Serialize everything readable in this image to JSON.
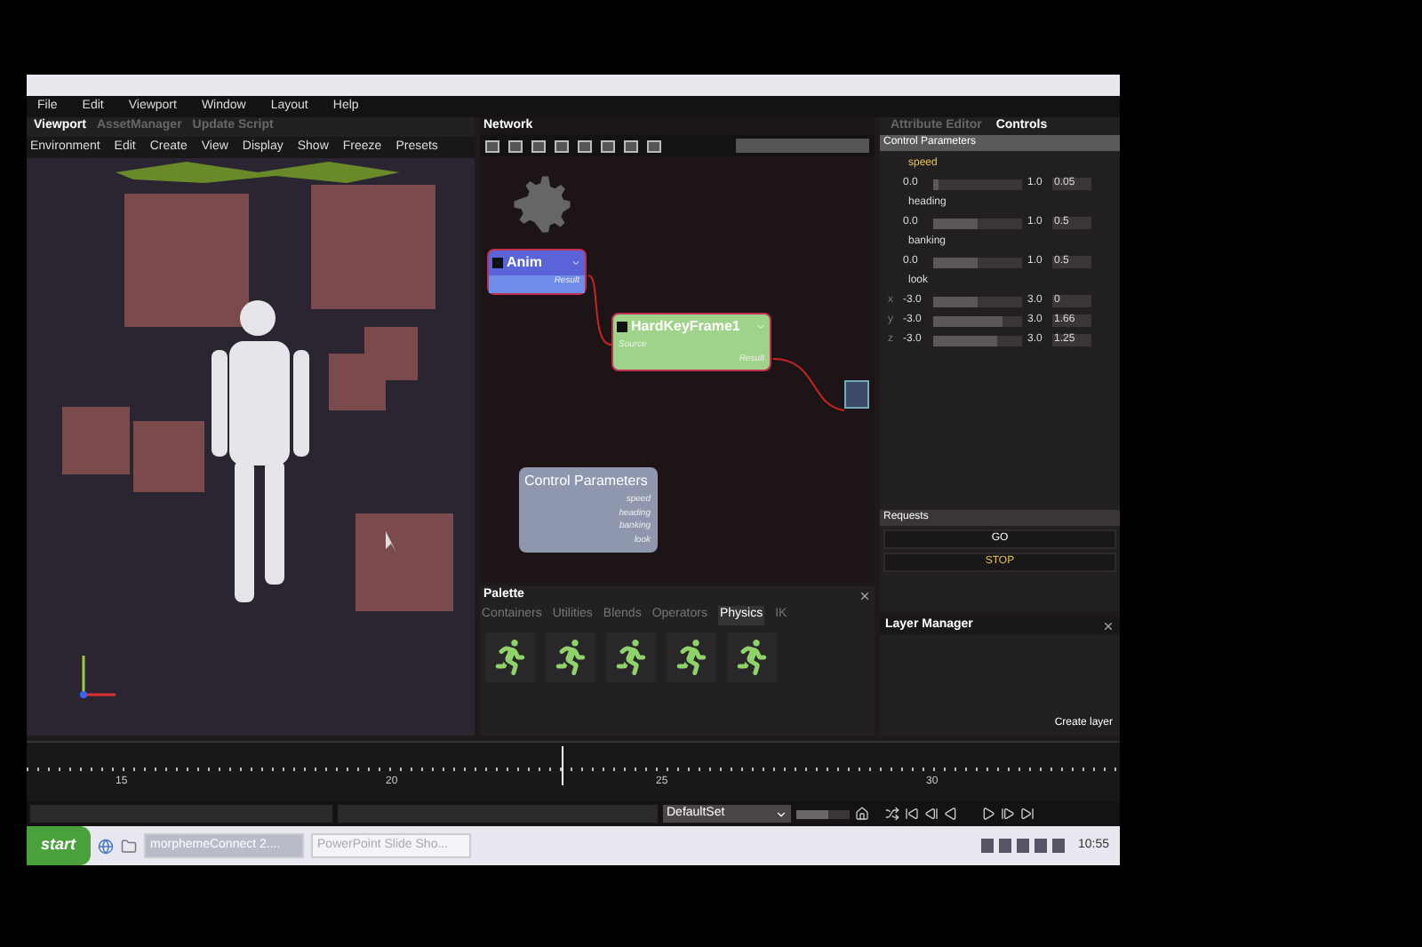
{
  "menu": [
    "File",
    "Edit",
    "Viewport",
    "Window",
    "Layout",
    "Help"
  ],
  "viewport": {
    "tabs": [
      {
        "label": "Viewport",
        "selected": true
      },
      {
        "label": "AssetManager",
        "selected": false
      },
      {
        "label": "Update Script",
        "selected": false
      }
    ],
    "toolbar": [
      "Environment",
      "Edit",
      "Create",
      "View",
      "Display",
      "Show",
      "Freeze",
      "Presets"
    ]
  },
  "network": {
    "title": "Network",
    "nodes": [
      {
        "kind": "anim",
        "title": "Anim",
        "outputs": [
          "Result"
        ]
      },
      {
        "kind": "keyframe",
        "title": "HardKeyFrame1",
        "inputs": [
          "Source"
        ],
        "outputs": [
          "Result"
        ]
      },
      {
        "kind": "params",
        "title": "Control Parameters",
        "outputs": [
          "speed",
          "heading",
          "banking",
          "look"
        ]
      }
    ]
  },
  "palette": {
    "title": "Palette",
    "tabs": [
      {
        "label": "Containers",
        "selected": false
      },
      {
        "label": "Utilities",
        "selected": false
      },
      {
        "label": "Blends",
        "selected": false
      },
      {
        "label": "Operators",
        "selected": false
      },
      {
        "label": "Physics",
        "selected": true
      },
      {
        "label": "IK",
        "selected": false
      }
    ]
  },
  "controls": {
    "tabs": [
      {
        "label": "Attribute Editor",
        "selected": false
      },
      {
        "label": "Controls",
        "selected": true
      }
    ],
    "section": "Control Parameters",
    "params": [
      {
        "name": "speed",
        "selected": true,
        "rows": [
          {
            "min": "0.0",
            "max": "1.0",
            "value": "0.05",
            "level": 0.05
          }
        ]
      },
      {
        "name": "heading",
        "selected": false,
        "rows": [
          {
            "min": "0.0",
            "max": "1.0",
            "value": "0.5",
            "level": 0.5
          }
        ]
      },
      {
        "name": "banking",
        "selected": false,
        "rows": [
          {
            "min": "0.0",
            "max": "1.0",
            "value": "0.5",
            "level": 0.5
          }
        ]
      },
      {
        "name": "look",
        "selected": false,
        "rows": [
          {
            "axis": "x",
            "min": "-3.0",
            "max": "3.0",
            "value": "0",
            "level": 0.5
          },
          {
            "axis": "y",
            "min": "-3.0",
            "max": "3.0",
            "value": "1.66",
            "level": 0.78
          },
          {
            "axis": "z",
            "min": "-3.0",
            "max": "3.0",
            "value": "1.25",
            "level": 0.71
          }
        ]
      }
    ],
    "requests_title": "Requests",
    "requests": [
      {
        "label": "GO",
        "selected": false
      },
      {
        "label": "STOP",
        "selected": true
      }
    ]
  },
  "layer_manager": {
    "title": "Layer Manager",
    "button": "Create layer"
  },
  "timeline": {
    "ticks": [
      "15",
      "20",
      "25",
      "30"
    ],
    "level": 0.49
  },
  "transport": {
    "set": "DefaultSet",
    "speed": {
      "level": 0.6
    }
  },
  "taskbar": {
    "start": "start",
    "tasks": [
      {
        "label": "morphemeConnect 2....",
        "selected": true
      },
      {
        "label": "PowerPoint Slide Sho...",
        "selected": false
      }
    ],
    "clock": "10:55"
  }
}
